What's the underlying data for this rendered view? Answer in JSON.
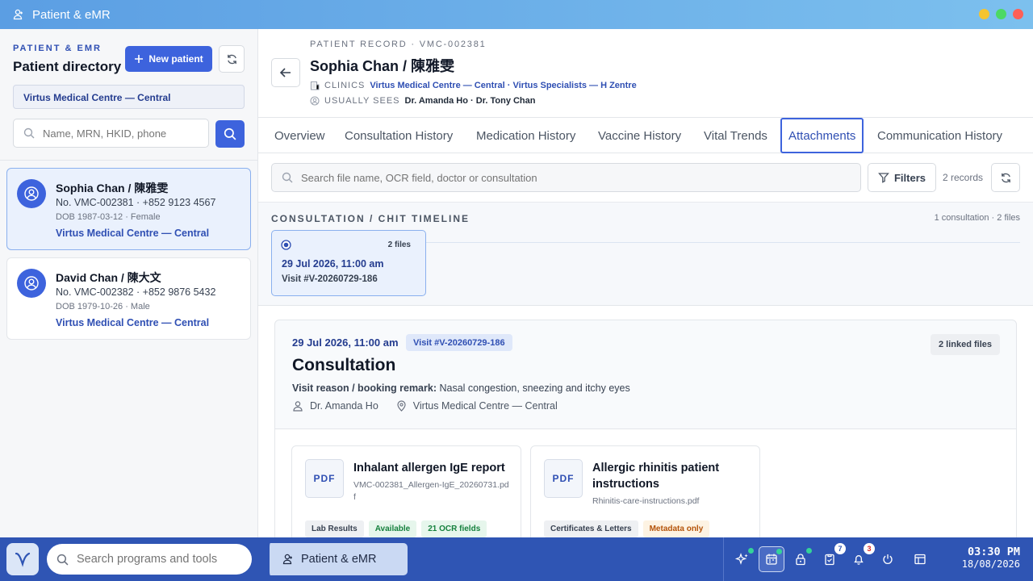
{
  "window": {
    "title": "Patient & eMR",
    "controls": {
      "minimize_color": "#f4c430",
      "maximize_color": "#4cd964",
      "close_color": "#ff5f57"
    }
  },
  "sidebar": {
    "eyebrow": "PATIENT & EMR",
    "title": "Patient directory",
    "new_patient_label": "New patient",
    "clinic_filter": "Virtus Medical Centre — Central",
    "search_placeholder": "Name, MRN, HKID, phone",
    "patients": [
      {
        "name": "Sophia Chan / 陳雅雯",
        "number": "No. VMC-002381 · +852 9123 4567",
        "dob": "DOB 1987-03-12 · Female",
        "clinic": "Virtus Medical Centre — Central",
        "selected": true
      },
      {
        "name": "David Chan / 陳大文",
        "number": "No. VMC-002382 · +852 9876 5432",
        "dob": "DOB 1979-10-26 · Male",
        "clinic": "Virtus Medical Centre — Central",
        "selected": false
      }
    ]
  },
  "record": {
    "eyebrow": "PATIENT RECORD · VMC-002381",
    "title": "Sophia Chan / 陳雅雯",
    "clinics_key": "CLINICS",
    "clinics_value": "Virtus Medical Centre — Central · Virtus Specialists — H Zentre",
    "usually_sees_key": "USUALLY SEES",
    "usually_sees_value": "Dr. Amanda Ho · Dr. Tony Chan"
  },
  "tabs": [
    {
      "label": "Overview"
    },
    {
      "label": "Consultation History"
    },
    {
      "label": "Medication History"
    },
    {
      "label": "Vaccine History"
    },
    {
      "label": "Vital Trends"
    },
    {
      "label": "Attachments",
      "active": true
    },
    {
      "label": "Communication History"
    }
  ],
  "attachments": {
    "search_placeholder": "Search file name, OCR field, doctor or consultation",
    "filters_label": "Filters",
    "record_count": "2 records",
    "timeline": {
      "label": "CONSULTATION / CHIT TIMELINE",
      "summary": "1 consultation · 2 files",
      "card": {
        "files": "2 files",
        "date": "29 Jul 2026, 11:00 am",
        "visit": "Visit #V-20260729-186"
      }
    },
    "consultation": {
      "date": "29 Jul 2026, 11:00 am",
      "visit": "Visit #V-20260729-186",
      "linked_files": "2 linked files",
      "title": "Consultation",
      "reason_label": "Visit reason / booking remark:",
      "reason_text": "Nasal congestion, sneezing and itchy eyes",
      "doctor": "Dr. Amanda Ho",
      "clinic": "Virtus Medical Centre — Central"
    },
    "files": [
      {
        "type": "PDF",
        "title": "Inhalant allergen IgE report",
        "filename": "VMC-002381_Allergen-IgE_20260731.pdf",
        "tags": [
          "Lab Results",
          "Available",
          "21 OCR fields"
        ]
      },
      {
        "type": "PDF",
        "title": "Allergic rhinitis patient instructions",
        "filename": "Rhinitis-care-instructions.pdf",
        "tags": [
          "Certificates & Letters",
          "Metadata only"
        ]
      }
    ]
  },
  "taskbar": {
    "search_placeholder": "Search programs and tools",
    "active_app": "Patient & eMR",
    "tasks_badge": "7",
    "notifications_badge": "3",
    "time": "03:30 PM",
    "date": "18/08/2026"
  },
  "colors": {
    "accent": "#3d63dd",
    "title_gradient_start": "#5b9ee3",
    "taskbar": "#2f55b4"
  }
}
